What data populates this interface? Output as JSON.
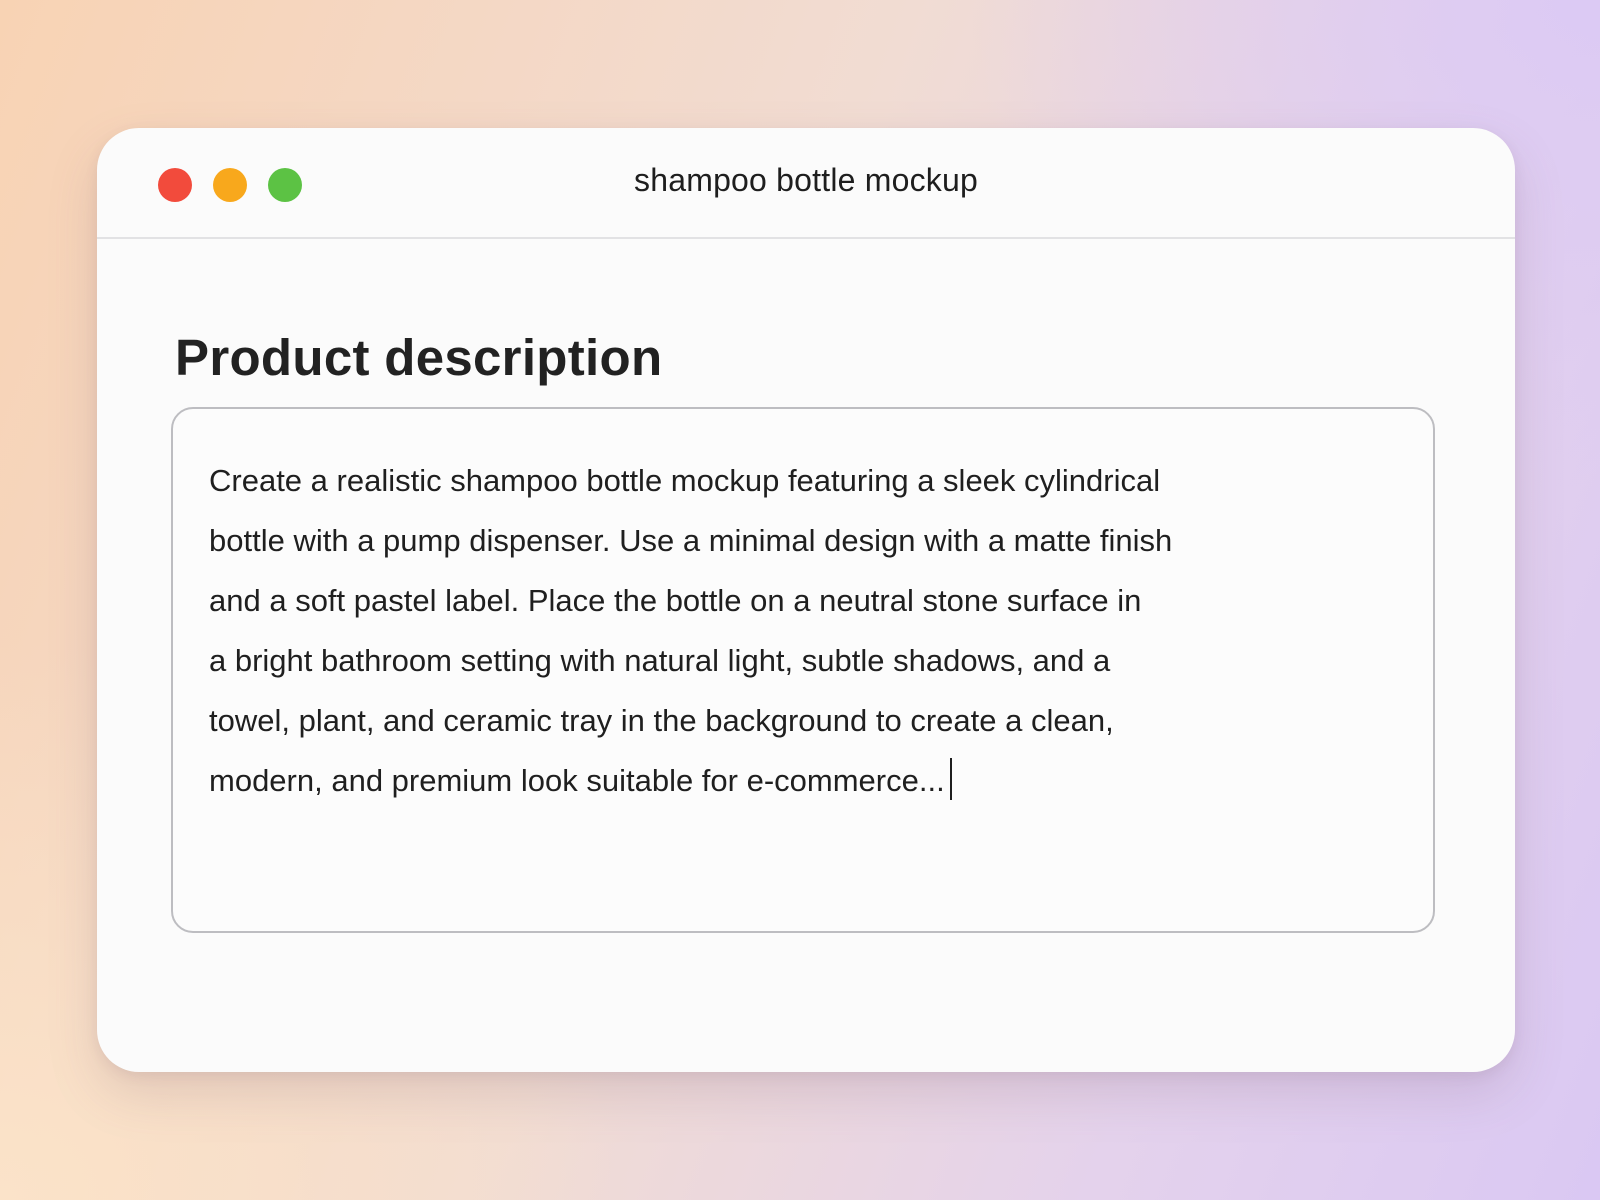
{
  "window": {
    "title": "shampoo bottle mockup",
    "controls": {
      "close_color": "#f24b3c",
      "minimize_color": "#f8a81c",
      "zoom_color": "#5cc244"
    }
  },
  "main": {
    "heading": "Product description",
    "description": {
      "value": "Create a realistic shampoo bottle mockup featuring a sleek cylindrical\nbottle with a pump dispenser. Use a minimal design with a matte finish\nand a soft pastel label. Place the bottle on a neutral stone surface in\na bright bathroom setting with natural light, subtle shadows, and a\ntowel, plant, and ceramic tray in the background to create a clean,\nmodern, and premium look suitable for e-commerce...",
      "has_text_cursor": true
    }
  }
}
